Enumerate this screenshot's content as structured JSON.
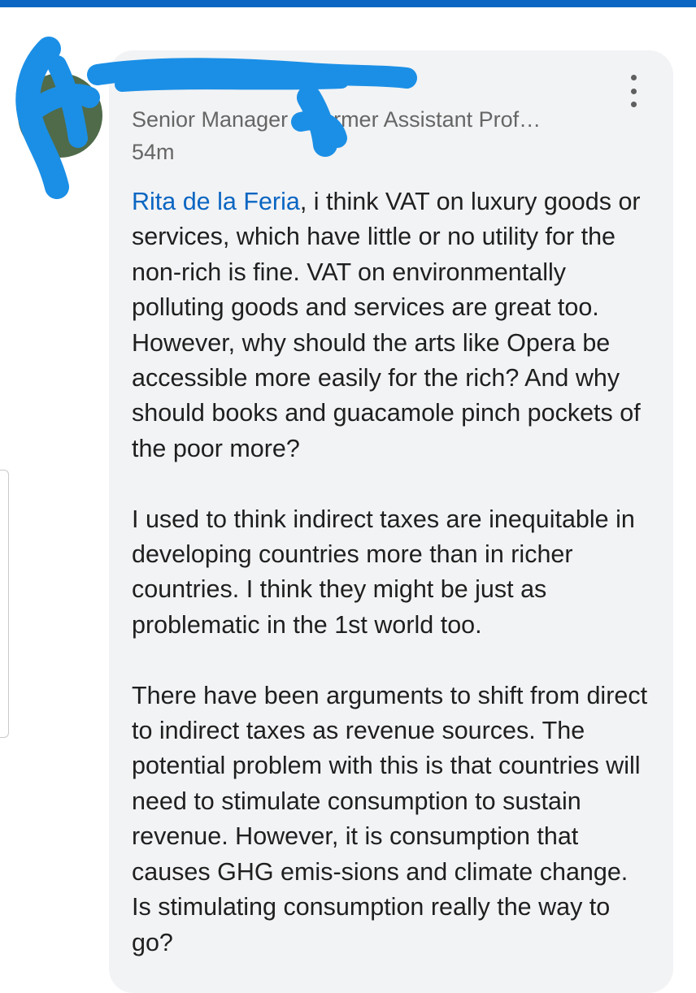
{
  "comment": {
    "author_name": "",
    "headline": "Senior Manager • Former Assistant Prof…",
    "timestamp": "54m",
    "more_icon": "more-vertical-icon",
    "mention": "Rita de la Feria",
    "paragraph_1_rest": ", i think VAT on luxury goods or services, which have little or no utility for the non-rich is fine. VAT on environmentally polluting goods and services are great too. However, why should the arts like Opera be accessible more easily for the rich? And why should books and guacamole pinch pockets of the poor more?",
    "paragraphs": [
      "I used to think indirect taxes are inequitable in developing countries more than in richer countries. I think they might be just as problematic in the 1st world too.",
      "There have been arguments to shift from direct to indirect taxes as revenue sources. The potential problem with this is that countries will need to stimulate consumption to sustain revenue. However, it is consumption that causes GHG emis-sions and climate change. Is stimulating consumption really the way to go?"
    ]
  },
  "colors": {
    "accent": "#0a66c2",
    "card_background": "#f2f3f5",
    "redaction": "#1b8fe6"
  }
}
